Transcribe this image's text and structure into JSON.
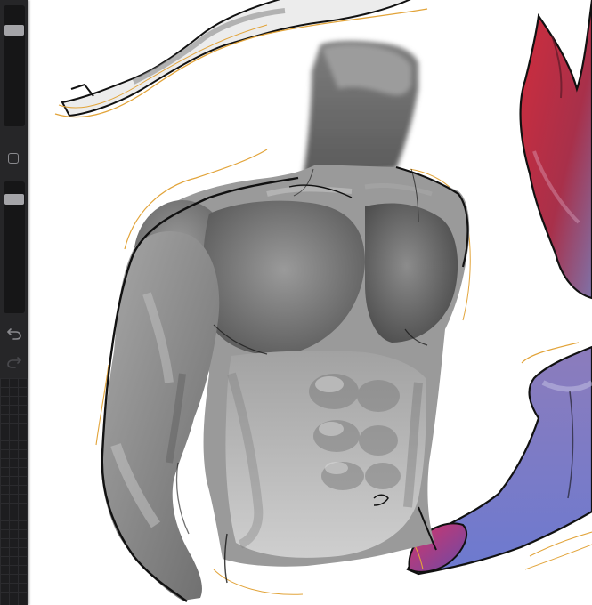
{
  "app": {
    "name": "drawing-canvas",
    "background": "#ffffff"
  },
  "sidebar": {
    "background": "#262628",
    "brush_size_slider": {
      "level": 0.82,
      "icon": "slider-thumb"
    },
    "modify_button": {
      "icon": "square-outline-icon"
    },
    "brush_opacity_slider": {
      "level": 0.9,
      "icon": "slider-thumb"
    },
    "undo_button": {
      "icon": "undo-arrow-icon"
    },
    "redo_button": {
      "icon": "redo-arrow-icon",
      "enabled": false
    }
  },
  "canvas": {
    "artwork": [
      {
        "name": "torso-study",
        "description_colors": [
          "#8e8e8e",
          "#5a5a5a",
          "#c4c4c4"
        ]
      },
      {
        "name": "white-limb-sketch",
        "description_colors": [
          "#e8e8e8",
          "#9a9a9a"
        ]
      },
      {
        "name": "red-creature-sketch",
        "description_colors": [
          "#c42a3a",
          "#7a6aa0"
        ]
      },
      {
        "name": "purple-paw-sketch",
        "description_colors": [
          "#7a78c0",
          "#c03a6a"
        ]
      }
    ],
    "sketch_line_color": "#e2a43a",
    "ink_color": "#111111"
  }
}
